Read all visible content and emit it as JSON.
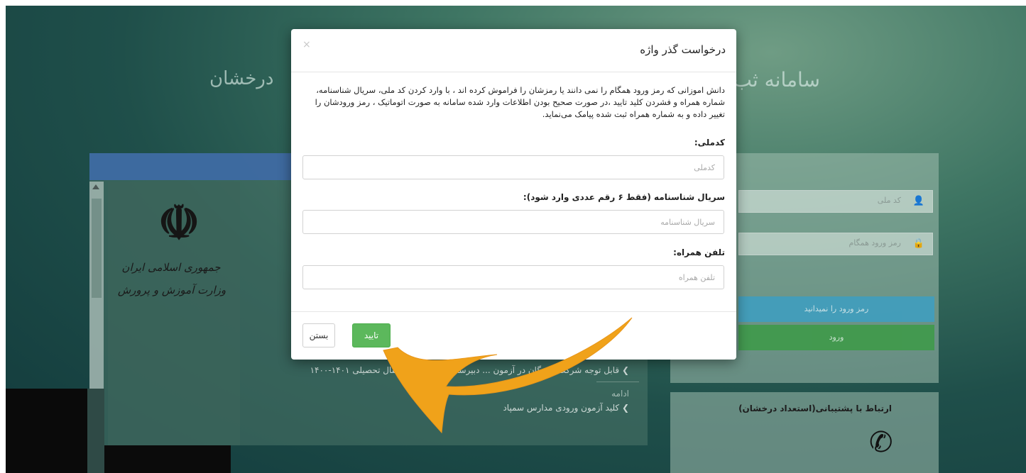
{
  "background": {
    "title_right": "سامانه ثب",
    "title_left": "درخشان",
    "emblem": {
      "line1": "جمهوری اسلامی ایران",
      "line2": "وزارت آموزش و پرورش"
    },
    "login": {
      "national_code_placeholder": "کد ملی",
      "password_placeholder": "رمز ورود همگام",
      "forgot_button": "رمز ورود را نمیدانید",
      "login_button": "ورود"
    },
    "news": [
      {
        "text": "قابل توجه شرکت کنندگان در آزمون ... دبیرستان‌های درخشان سال تحصیلی ۱۴۰۱-۱۴۰۰"
      },
      {
        "text": "ادامه"
      },
      {
        "text": "کلید آزمون ورودی مدارس سمپاد"
      }
    ],
    "support_title": "ارتباط با پشتیبانی(استعداد درخشان)"
  },
  "modal": {
    "title": "درخواست گذر واژه",
    "close_symbol": "×",
    "description": "دانش اموزانی که رمز ورود همگام را نمی دانند یا رمزشان را فراموش کرده اند ، با وارد کردن کد ملی، سریال شناسنامه، شماره همراه و فشردن کلید تایید ،در صورت صحیح بودن اطلاعات وارد شده سامانه به صورت اتوماتیک ، رمز ورودشان را تغییر داده و به شماره همراه ثبت شده پیامک می‌نماید.",
    "fields": {
      "national_code": {
        "label": "کدملی:",
        "placeholder": "کدملی",
        "value": ""
      },
      "serial": {
        "label": "سریال شناسنامه (فقط ۶ رقم عددی وارد شود):",
        "placeholder": "سریال شناسنامه",
        "value": ""
      },
      "mobile": {
        "label": "تلفن همراه:",
        "placeholder": "تلفن همراه",
        "value": ""
      }
    },
    "buttons": {
      "close": "بستن",
      "confirm": "تایید"
    }
  },
  "colors": {
    "confirm_green": "#5cb85c",
    "annotation_arrow": "#f0a21a",
    "info_blue": "#3d9fc2"
  }
}
